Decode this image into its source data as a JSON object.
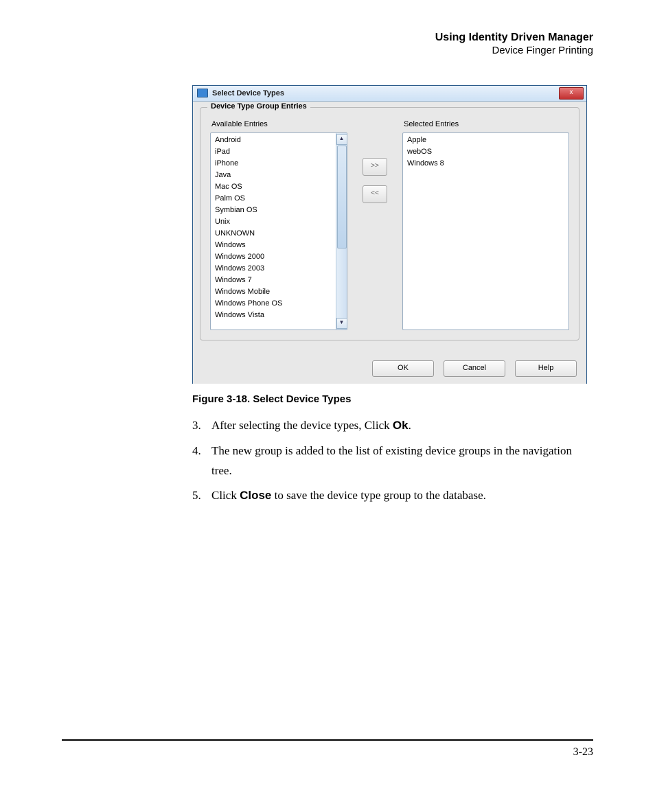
{
  "header": {
    "line1": "Using Identity Driven Manager",
    "line2": "Device Finger Printing"
  },
  "dialog": {
    "title": "Select Device Types",
    "close": "x",
    "group_legend": "Device Type Group Entries",
    "available_label": "Available Entries",
    "selected_label": "Selected Entries",
    "available": [
      "Android",
      "iPad",
      "iPhone",
      "Java",
      "Mac OS",
      "Palm OS",
      "Symbian OS",
      "Unix",
      "UNKNOWN",
      "Windows",
      "Windows 2000",
      "Windows 2003",
      "Windows 7",
      "Windows Mobile",
      "Windows Phone OS",
      "Windows Vista"
    ],
    "selected": [
      "Apple",
      "webOS",
      "Windows 8"
    ],
    "btn_add": ">>",
    "btn_remove": "<<",
    "btn_ok": "OK",
    "btn_cancel": "Cancel",
    "btn_help": "Help",
    "sb_up": "▲",
    "sb_down": "▼"
  },
  "caption": "Figure 3-18. Select Device Types",
  "steps": {
    "n3": "3.",
    "t3a": "After selecting the device types, Click ",
    "t3b": "Ok",
    "t3c": ".",
    "n4": "4.",
    "t4": "The new group is added to the list of existing device groups in the navigation tree.",
    "n5": "5.",
    "t5a": "Click ",
    "t5b": "Close",
    "t5c": " to save the device type group to the database."
  },
  "page_number": "3-23"
}
